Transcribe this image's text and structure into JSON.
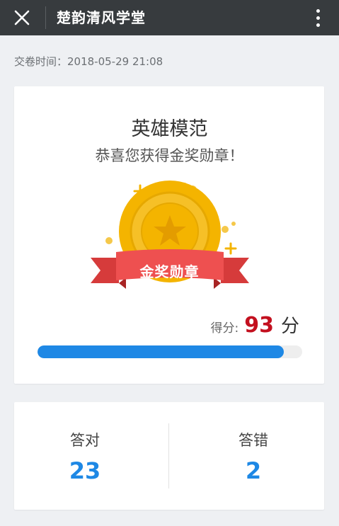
{
  "header": {
    "close_icon": "close-icon",
    "title": "楚韵清风学堂",
    "more_icon": "more-vertical-icon"
  },
  "submission": {
    "time_text": "交卷时间：2018-05-29 21:08"
  },
  "result": {
    "title": "英雄模范",
    "subtitle": "恭喜您获得金奖勋章！",
    "medal_icon": "gold-medal-icon",
    "ribbon_text": "金奖勋章",
    "score_label": "得分:",
    "score_value": "93",
    "score_unit": "分",
    "score_progress_percent": 93
  },
  "stats": {
    "correct_label": "答对",
    "correct_value": "23",
    "wrong_label": "答错",
    "wrong_value": "2"
  },
  "colors": {
    "header_bg": "#373b3e",
    "accent_blue": "#1e88e5",
    "score_red": "#c3101f",
    "gold": "#f4b400",
    "ribbon_red": "#e84b4b"
  }
}
